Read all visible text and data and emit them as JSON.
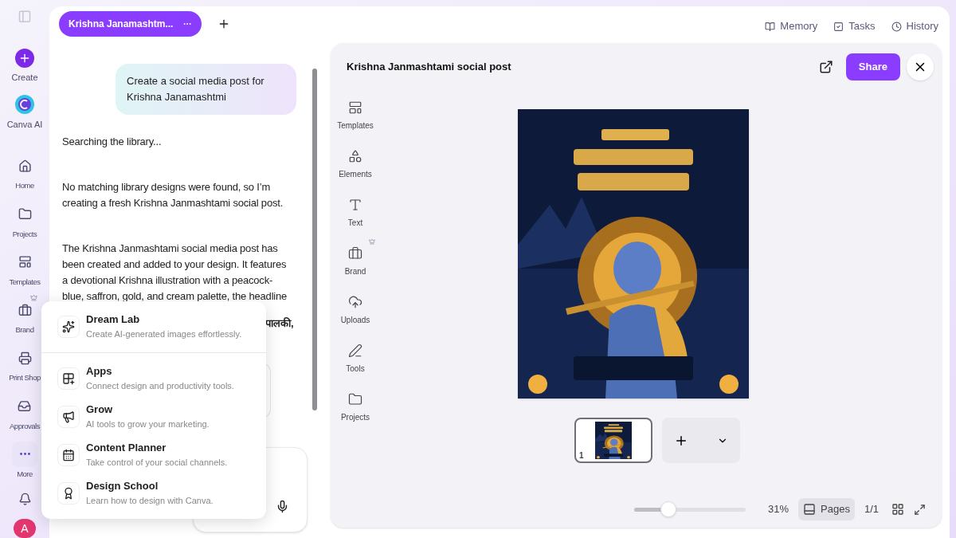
{
  "sidebar": {
    "items": [
      {
        "label": "Create",
        "kind": "create"
      },
      {
        "label": "Canva AI",
        "kind": "ai"
      },
      {
        "label": "Home",
        "kind": "nav",
        "selected": false
      },
      {
        "label": "Projects",
        "kind": "nav",
        "selected": false
      },
      {
        "label": "Templates",
        "kind": "nav",
        "selected": false
      },
      {
        "label": "Brand",
        "kind": "nav",
        "selected": false
      },
      {
        "label": "Print Shop",
        "kind": "nav",
        "selected": false
      },
      {
        "label": "Approvals",
        "kind": "nav",
        "selected": false
      },
      {
        "label": "More",
        "kind": "nav",
        "selected": true
      }
    ],
    "avatar": "A"
  },
  "chat": {
    "tab": {
      "title": "Krishna Janamashtm...",
      "selected": true
    },
    "messages": [
      {
        "kind": "user",
        "text": "Create a social media post for Krishna Janamashtmi"
      },
      {
        "kind": "assistant",
        "text": "Searching the library..."
      },
      {
        "kind": "assistant",
        "text": "No matching library designs were found, so I’m creating a fresh Krishna Janmashtami social post."
      },
      {
        "kind": "assistant",
        "text": "The Krishna Janmashtami social media post has been created and added to your design. It features a devotional Krishna illustration with a peacock-blue, saffron, gold, and cream palette, the headline"
      }
    ],
    "hidden_fragment": "पालकी,"
  },
  "top_links": [
    "Memory",
    "Tasks",
    "History"
  ],
  "editor": {
    "title": "Krishna Janmashtami social post",
    "share": "Share",
    "tools": [
      "Templates",
      "Elements",
      "Text",
      "Brand",
      "Uploads",
      "Tools",
      "Projects"
    ],
    "thumbnail": {
      "page": "1",
      "selected": true
    },
    "zoom": {
      "level": 0.31,
      "reading": "31%"
    },
    "pages_button": "Pages",
    "page_count": "1/1"
  },
  "more_menu": [
    {
      "title": "Dream Lab",
      "description": "Create AI-generated images effortlessly."
    },
    {
      "title": "Apps",
      "description": "Connect design and productivity tools."
    },
    {
      "title": "Grow",
      "description": "AI tools to grow your marketing."
    },
    {
      "title": "Content Planner",
      "description": "Take control of your social channels."
    },
    {
      "title": "Design School",
      "description": "Learn how to design with Canva."
    }
  ]
}
